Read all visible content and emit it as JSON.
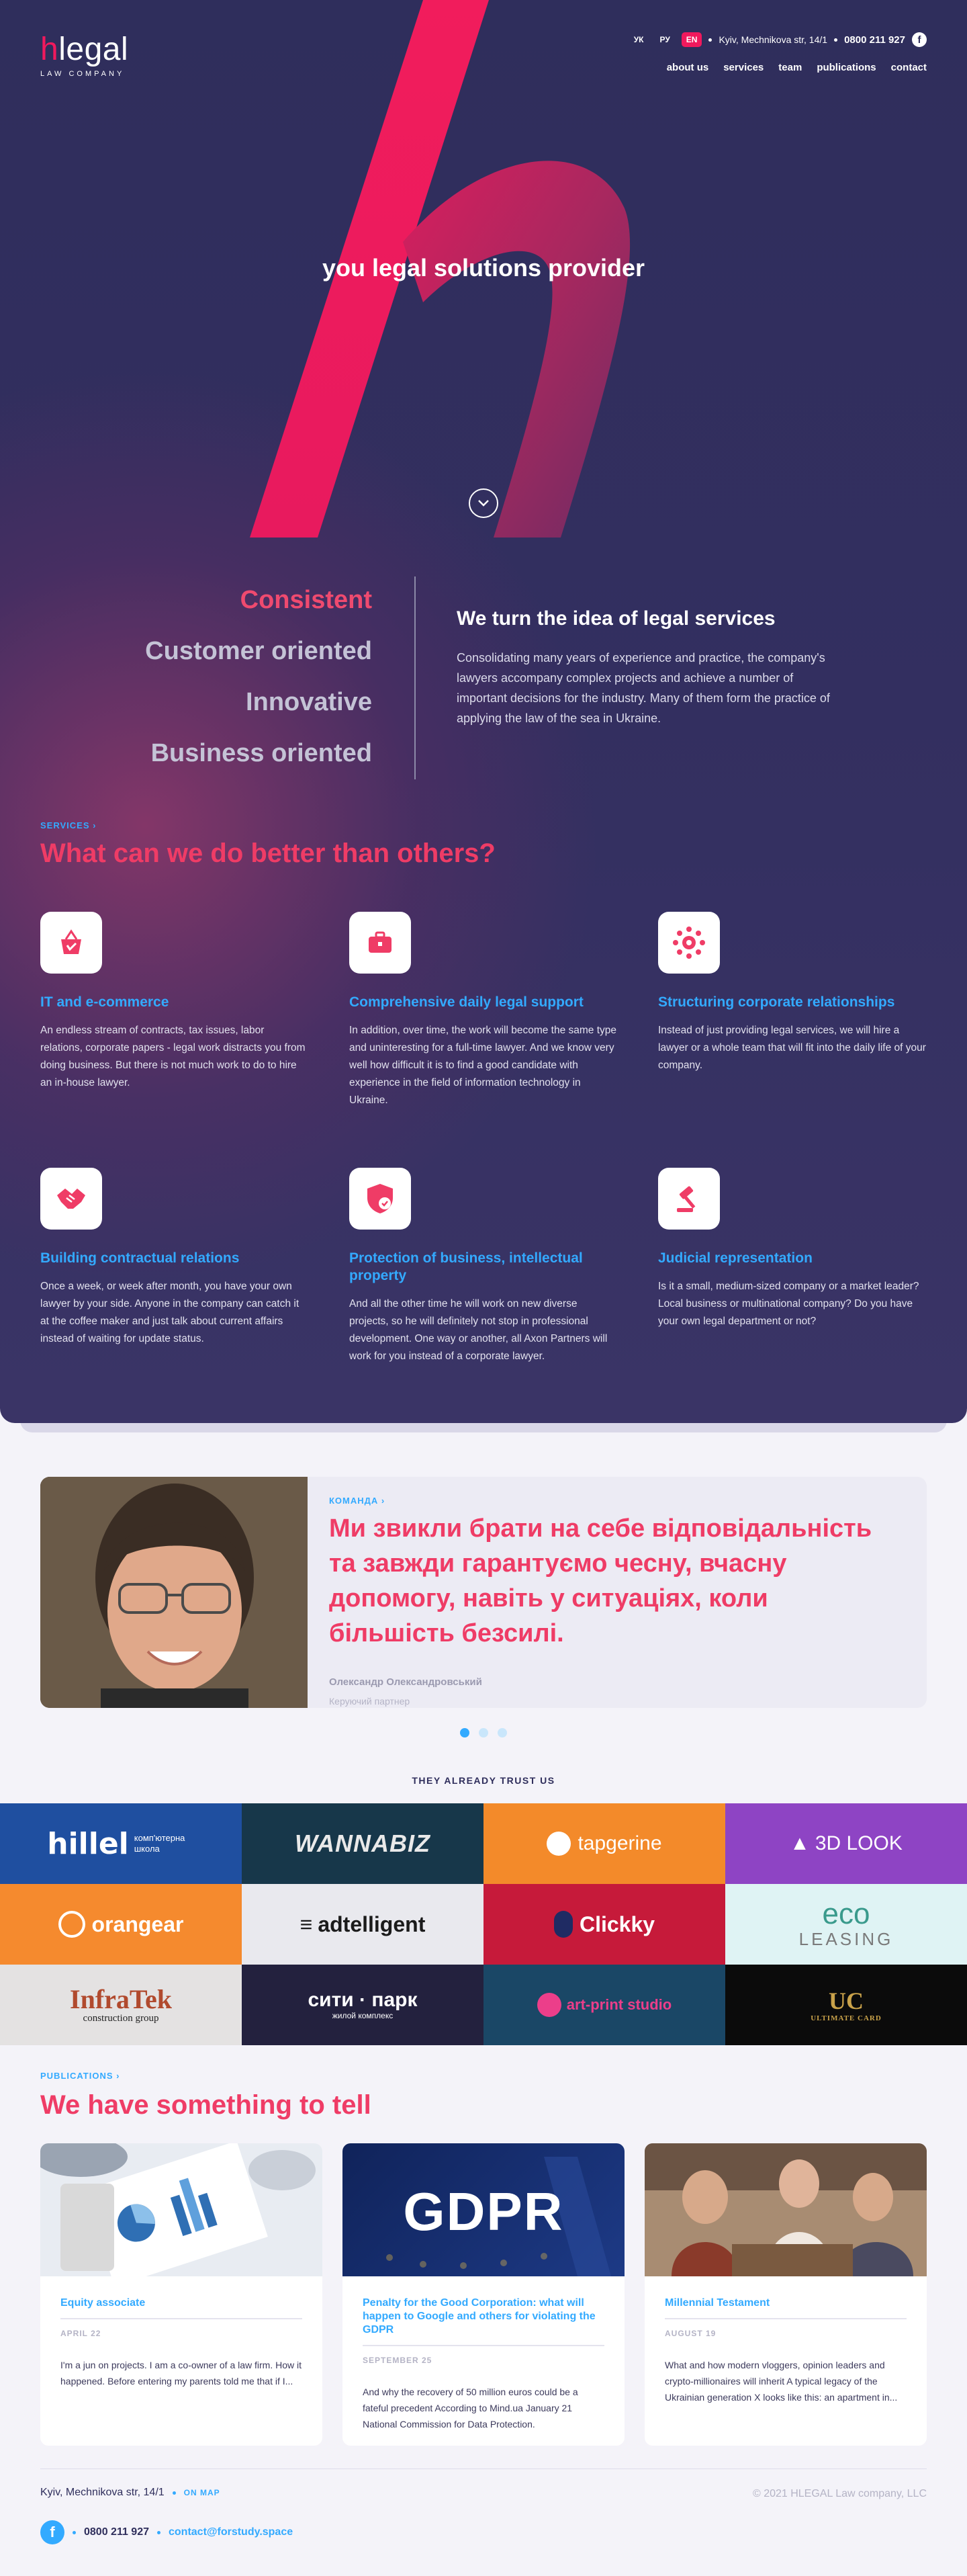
{
  "brand": {
    "logo_h": "h",
    "logo_rest": "legal",
    "tagline": "LAW COMPANY"
  },
  "header": {
    "languages": [
      "УК",
      "РУ",
      "EN"
    ],
    "address": "Kyiv, Mechnikova str, 14/1",
    "phone": "0800 211 927",
    "facebook_icon": "facebook-icon",
    "nav": [
      "about us",
      "services",
      "team",
      "publications",
      "contact"
    ]
  },
  "hero": {
    "title": "you legal solutions provider",
    "scroll_icon": "chevron-down-icon"
  },
  "values": {
    "items": [
      "Consistent",
      "Customer oriented",
      "Innovative",
      "Business oriented"
    ],
    "heading": "We turn the idea of legal services",
    "text": "Consolidating many years of experience and practice, the company's lawyers accompany complex projects and achieve a number of important decisions for the industry. Many of them form the practice of applying the law of the sea in Ukraine."
  },
  "services": {
    "eyebrow": "SERVICES",
    "title": "What can we do better than others?",
    "items": [
      {
        "icon": "shopping-basket-icon",
        "title": "IT and e-commerce",
        "text": "An endless stream of contracts, tax issues, labor relations, corporate papers - legal work distracts you from doing business. But there is not much work to do to hire an in-house lawyer."
      },
      {
        "icon": "briefcase-icon",
        "title": "Comprehensive daily legal support",
        "text": "In addition, over time, the work will become the same type and uninteresting for a full-time lawyer. And we know very well how difficult it is to find a good candidate with experience in the field of information technology in Ukraine."
      },
      {
        "icon": "network-icon",
        "title": "Structuring corporate relationships",
        "text": "Instead of just providing legal services, we will hire a lawyer or a whole team that will fit into the daily life of your company."
      },
      {
        "icon": "handshake-icon",
        "title": "Building contractual relations",
        "text": "Once a week, or week after month, you have your own lawyer by your side. Anyone in the company can catch it at the coffee maker and just talk about current affairs instead of waiting for update status."
      },
      {
        "icon": "shield-check-icon",
        "title": "Protection of business, intellectual property",
        "text": "And all the other time he will work on new diverse projects, so he will definitely not stop in professional development. One way or another, all Axon Partners will work for you instead of a corporate lawyer."
      },
      {
        "icon": "gavel-icon",
        "title": "Judicial representation",
        "text": "Is it a small, medium-sized company or a market leader? Local business or multinational company? Do you have your own legal department or not?"
      }
    ]
  },
  "team": {
    "eyebrow": "КОМАНДА",
    "quote": "Ми звикли брати на себе відповідальність та завжди гарантуємо чесну, вчасну допомогу, навіть у ситуаціях, коли більшість безсилі.",
    "name": "Олександр Олександровський",
    "role": "Керуючий партнер",
    "pages": 3,
    "active_page": 1
  },
  "clients": {
    "title": "THEY ALREADY TRUST US",
    "items": [
      {
        "name": "hillel",
        "sub": "комп'ютерна школа",
        "bg": "#1f4fa0",
        "fg": "#ffffff"
      },
      {
        "name": "WANNABIZ",
        "sub": "",
        "bg": "#17374a",
        "fg": "#e9e9e9"
      },
      {
        "name": "tapgerine",
        "sub": "",
        "bg": "#f38a2a",
        "fg": "#ffffff"
      },
      {
        "name": "3D LOOK",
        "sub": "",
        "bg": "#8e44c4",
        "fg": "#ffffff"
      },
      {
        "name": "orangear",
        "sub": "",
        "bg": "#f58a2e",
        "fg": "#ffffff"
      },
      {
        "name": "adtelligent",
        "sub": "",
        "bg": "#e9e9ee",
        "fg": "#1b1b1b"
      },
      {
        "name": "Clickky",
        "sub": "",
        "bg": "#c61a3a",
        "fg": "#ffffff"
      },
      {
        "name": "eco",
        "sub": "LEASING",
        "bg": "#dff3f4",
        "fg": "#3a9a8c"
      },
      {
        "name": "InfraTek",
        "sub": "construction group",
        "bg": "#e4e2e2",
        "fg": "#b14a2e"
      },
      {
        "name": "сити · парк",
        "sub": "жилой комплекс",
        "bg": "#23213e",
        "fg": "#ffffff"
      },
      {
        "name": "art-print studio",
        "sub": "",
        "bg": "#1a4766",
        "fg": "#ec3e8a"
      },
      {
        "name": "UC",
        "sub": "ULTIMATE CARD",
        "bg": "#0b0b0b",
        "fg": "#c9a24a"
      }
    ]
  },
  "publications": {
    "eyebrow": "PUBLICATIONS",
    "title": "We have something to tell",
    "items": [
      {
        "title": "Equity associate",
        "date": "APRIL 22",
        "text": "I'm a jun on projects. I am a co-owner of a law firm. How it happened. Before entering my parents told me that if I...",
        "image": "business-charts-photo"
      },
      {
        "title": "Penalty for the Good Corporation: what will happen to Google and others for violating the GDPR",
        "date": "SEPTEMBER 25",
        "text": "And why the recovery of 50 million euros could be a fateful precedent According to Mind.ua January 21 National Commission for Data Protection.",
        "image": "gdpr-banner",
        "image_text": "GDPR"
      },
      {
        "title": "Millennial Testament",
        "date": "AUGUST 19",
        "text": "What and how modern vloggers, opinion leaders and crypto-millionaires will inherit A typical legacy of the Ukrainian generation X looks like this: an apartment in...",
        "image": "young-people-photo"
      }
    ]
  },
  "footer": {
    "address": "Kyiv, Mechnikova str, 14/1",
    "map_link": "ON MAP",
    "copyright": "© 2021 HLEGAL Law company, LLC",
    "phone": "0800 211 927",
    "email": "contact@forstudy.space"
  },
  "colors": {
    "accent": "#f0195d",
    "link": "#33aaff",
    "navy": "#2f2e5c"
  }
}
